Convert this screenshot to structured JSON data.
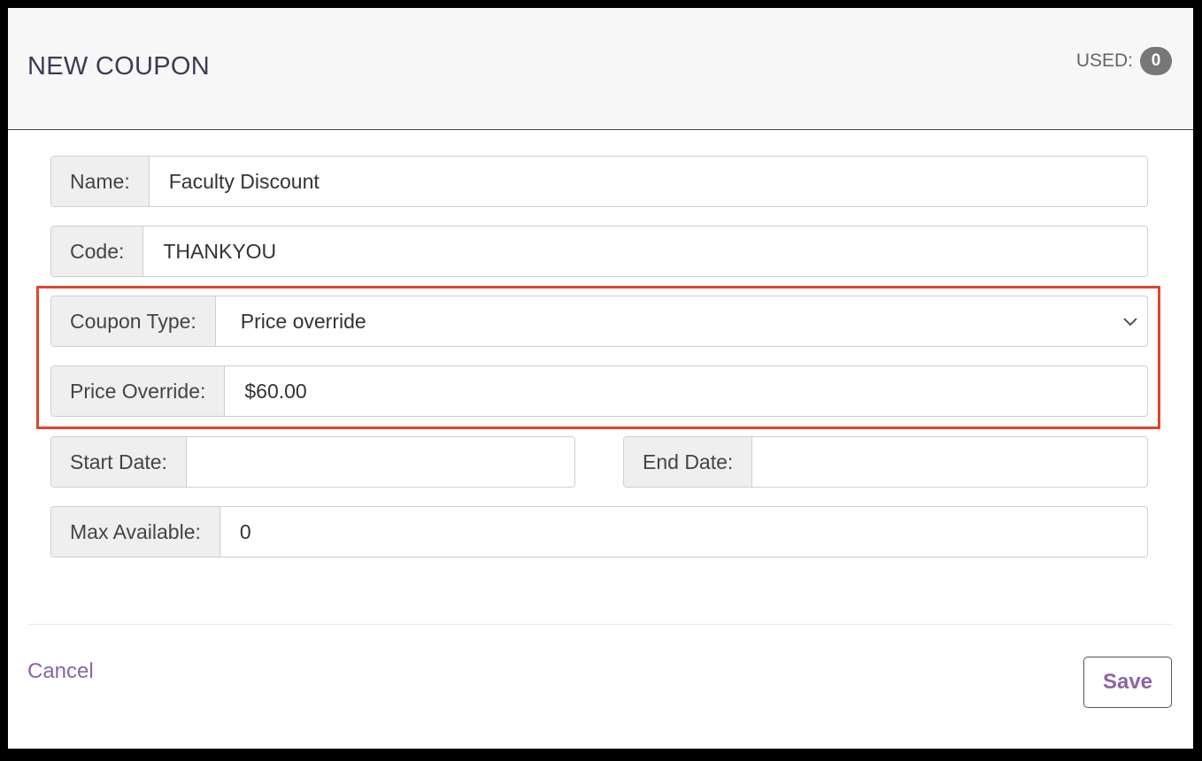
{
  "header": {
    "title": "NEW COUPON",
    "used_label": "USED:",
    "used_count": "0"
  },
  "form": {
    "name": {
      "label": "Name:",
      "value": "Faculty Discount"
    },
    "code": {
      "label": "Code:",
      "value": "THANKYOU"
    },
    "coupon_type": {
      "label": "Coupon Type:",
      "value": "Price override"
    },
    "price_override": {
      "label": "Price Override:",
      "value": "$60.00"
    },
    "start_date": {
      "label": "Start Date:",
      "value": ""
    },
    "end_date": {
      "label": "End Date:",
      "value": ""
    },
    "max_available": {
      "label": "Max Available:",
      "value": "0"
    }
  },
  "footer": {
    "cancel_label": "Cancel",
    "save_label": "Save"
  },
  "colors": {
    "accent": "#8e63a8",
    "highlight": "#e0452b",
    "badge": "#777777"
  },
  "icons": {
    "select": "chevron-down-icon"
  }
}
